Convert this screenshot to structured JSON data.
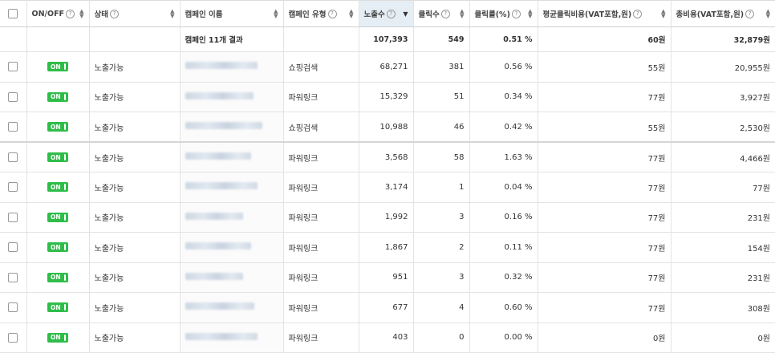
{
  "headers": {
    "onoff": "ON/OFF",
    "status": "상태",
    "name": "캠페인 이름",
    "type": "캠페인 유형",
    "impressions": "노출수",
    "clicks": "클릭수",
    "ctr": "클릭률(%)",
    "cpc": "평균클릭비용(VAT포함,원)",
    "cost": "총비용(VAT포함,원)"
  },
  "summary": {
    "label": "캠페인 11개 결과",
    "impressions": "107,393",
    "clicks": "549",
    "ctr": "0.51 %",
    "cpc": "60원",
    "cost": "32,879원"
  },
  "rows": [
    {
      "toggle": "ON",
      "status": "노출가능",
      "type": "쇼핑검색",
      "impressions": "68,271",
      "clicks": "381",
      "ctr": "0.56 %",
      "cpc": "55원",
      "cost": "20,955원"
    },
    {
      "toggle": "ON",
      "status": "노출가능",
      "type": "파워링크",
      "impressions": "15,329",
      "clicks": "51",
      "ctr": "0.34 %",
      "cpc": "77원",
      "cost": "3,927원"
    },
    {
      "toggle": "ON",
      "status": "노출가능",
      "type": "쇼핑검색",
      "impressions": "10,988",
      "clicks": "46",
      "ctr": "0.42 %",
      "cpc": "55원",
      "cost": "2,530원"
    },
    {
      "toggle": "ON",
      "status": "노출가능",
      "type": "파워링크",
      "impressions": "3,568",
      "clicks": "58",
      "ctr": "1.63 %",
      "cpc": "77원",
      "cost": "4,466원"
    },
    {
      "toggle": "ON",
      "status": "노출가능",
      "type": "파워링크",
      "impressions": "3,174",
      "clicks": "1",
      "ctr": "0.04 %",
      "cpc": "77원",
      "cost": "77원"
    },
    {
      "toggle": "ON",
      "status": "노출가능",
      "type": "파워링크",
      "impressions": "1,992",
      "clicks": "3",
      "ctr": "0.16 %",
      "cpc": "77원",
      "cost": "231원"
    },
    {
      "toggle": "ON",
      "status": "노출가능",
      "type": "파워링크",
      "impressions": "1,867",
      "clicks": "2",
      "ctr": "0.11 %",
      "cpc": "77원",
      "cost": "154원"
    },
    {
      "toggle": "ON",
      "status": "노출가능",
      "type": "파워링크",
      "impressions": "951",
      "clicks": "3",
      "ctr": "0.32 %",
      "cpc": "77원",
      "cost": "231원"
    },
    {
      "toggle": "ON",
      "status": "노출가능",
      "type": "파워링크",
      "impressions": "677",
      "clicks": "4",
      "ctr": "0.60 %",
      "cpc": "77원",
      "cost": "308원"
    },
    {
      "toggle": "ON",
      "status": "노출가능",
      "type": "파워링크",
      "impressions": "403",
      "clicks": "0",
      "ctr": "0.00 %",
      "cpc": "0원",
      "cost": "0원"
    }
  ],
  "colors": {
    "toggle_on": "#2fbd4a",
    "sorted_header": "#e6eef5"
  }
}
